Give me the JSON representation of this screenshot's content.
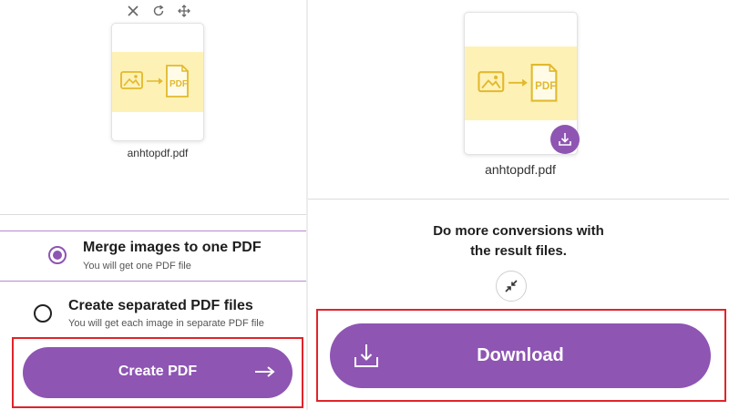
{
  "left": {
    "toolbar": {
      "icons": [
        "close-icon",
        "rotate-icon",
        "move-icon"
      ]
    },
    "file": {
      "name": "anhtopdf.pdf",
      "thumbnail_icon": "image-to-pdf-icon",
      "thumbnail_pdf_text": "PDF"
    },
    "options": [
      {
        "title": "Merge images to one PDF",
        "subtitle": "You will get one PDF file",
        "selected": true
      },
      {
        "title": "Create separated PDF files",
        "subtitle": "You will get each image in separate PDF file",
        "selected": false
      }
    ],
    "create_button": {
      "label": "Create PDF",
      "icon": "arrow-right-icon"
    }
  },
  "right": {
    "file": {
      "name": "anhtopdf.pdf",
      "thumbnail_icon": "image-to-pdf-icon",
      "thumbnail_pdf_text": "PDF",
      "badge_icon": "download-icon"
    },
    "conversions_text_line1": "Do more conversions with",
    "conversions_text_line2": "the result files.",
    "collapse_icon": "collapse-icon",
    "download_button": {
      "label": "Download",
      "icon": "download-icon"
    }
  },
  "colors": {
    "accent": "#8e55b3",
    "thumbnail_bg": "#fdf1b6",
    "thumbnail_line": "#e2b92d",
    "highlight": "#e0242a"
  }
}
